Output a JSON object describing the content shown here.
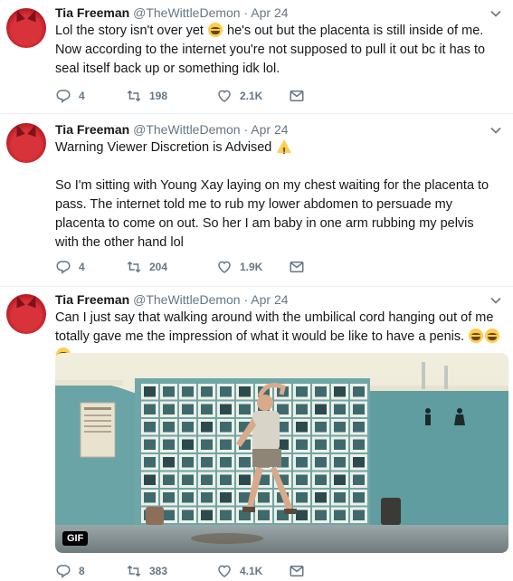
{
  "tweets": [
    {
      "name": "Tia Freeman",
      "handle": "@TheWittleDemon",
      "dot": "·",
      "time": "Apr 24",
      "text_before_emoji": "Lol the story isn't over yet",
      "text_after_emoji": " he's out but the placenta is still inside of me. Now according to the internet you're not supposed to pull it out bc it has to seal itself back up or something idk lol.",
      "replies": "4",
      "retweets": "198",
      "likes": "2.1K"
    },
    {
      "name": "Tia Freeman",
      "handle": "@TheWittleDemon",
      "dot": "·",
      "time": "Apr 24",
      "text_line1": "Warning Viewer Discretion is Advised",
      "text_para2": "So I'm sitting with Young Xay laying on my chest waiting for the placenta to pass. The internet told me to rub my lower abdomen to persuade my placenta to come on out. So her I am baby in one arm rubbing my pelvis with the other hand lol",
      "replies": "4",
      "retweets": "204",
      "likes": "1.9K"
    },
    {
      "name": "Tia Freeman",
      "handle": "@TheWittleDemon",
      "dot": "·",
      "time": "Apr 24",
      "text": "Can I just say that walking around with the umbilical cord hanging out of me totally gave me the impression of what it would be like to have a penis.",
      "media_badge": "GIF",
      "replies": "8",
      "retweets": "383",
      "likes": "4.1K"
    }
  ],
  "colors": {
    "icon": "#657786",
    "thread": "#cbd6de",
    "divider": "#e6ecf0",
    "avatar": "#d8323a"
  },
  "icons": [
    "reply-icon",
    "retweet-icon",
    "like-icon",
    "message-icon",
    "chevron-down-icon",
    "warning-emoji",
    "joy-emoji"
  ]
}
